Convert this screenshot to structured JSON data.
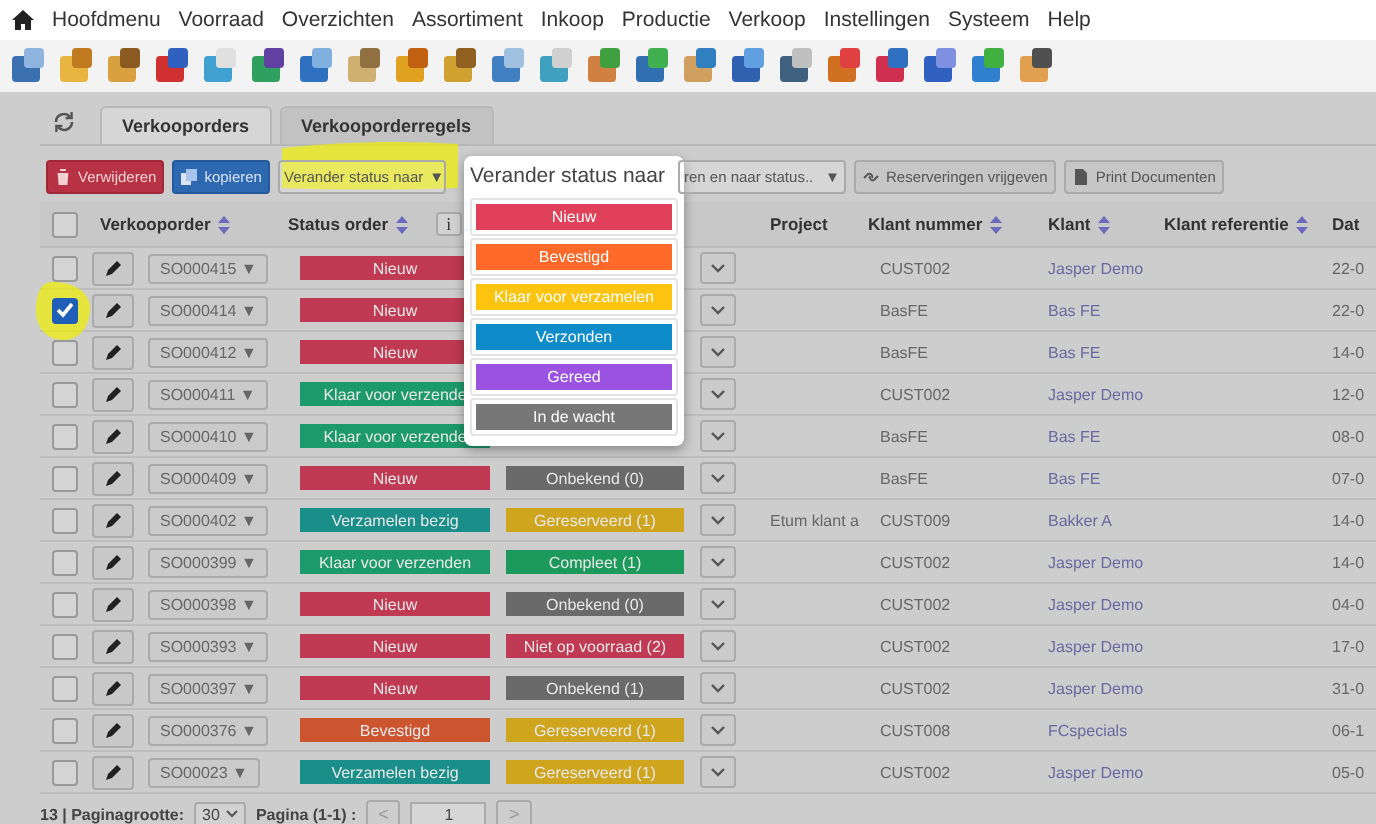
{
  "menu": [
    "Hoofdmenu",
    "Voorraad",
    "Overzichten",
    "Assortiment",
    "Inkoop",
    "Productie",
    "Verkoop",
    "Instellingen",
    "Systeem",
    "Help"
  ],
  "tabs": [
    {
      "label": "Verkooporders",
      "selected": true
    },
    {
      "label": "Verkooporderregels",
      "selected": false
    }
  ],
  "actions": {
    "delete": "Verwijderen",
    "copy": "kopieren",
    "status_select": "Verander status naar",
    "status_select_arrow": "▼",
    "cut_select": "ren en naar status..",
    "cut_select_arrow": "▼",
    "release": "Reserveringen vrijgeven",
    "print": "Print Documenten"
  },
  "columns": {
    "select_all_checked": false,
    "order": "Verkooporder",
    "status": "Status order",
    "info": "i",
    "project": "Project",
    "customer_no": "Klant nummer",
    "customer": "Klant",
    "reference": "Klant referentie",
    "date": "Dat"
  },
  "rows": [
    {
      "checked": false,
      "order": "SO000415 ▼",
      "status": {
        "label": "Nieuw",
        "color": "#bf3a52"
      },
      "customer_no": "CUST002",
      "customer": "Jasper Demo",
      "date": "22-0"
    },
    {
      "checked": true,
      "order": "SO000414 ▼",
      "status": {
        "label": "Nieuw",
        "color": "#bf3a52"
      },
      "customer_no": "BasFE",
      "customer": "Bas FE",
      "date": "22-0"
    },
    {
      "checked": false,
      "order": "SO000412 ▼",
      "status": {
        "label": "Nieuw",
        "color": "#bf3a52"
      },
      "customer_no": "BasFE",
      "customer": "Bas FE",
      "date": "14-0"
    },
    {
      "checked": false,
      "order": "SO000411 ▼",
      "status": {
        "label": "Klaar voor verzende",
        "color": "#1c9a6c"
      },
      "customer_no": "CUST002",
      "customer": "Jasper Demo",
      "date": "12-0"
    },
    {
      "checked": false,
      "order": "SO000410 ▼",
      "status": {
        "label": "Klaar voor verzende",
        "color": "#1c9a6c"
      },
      "customer_no": "BasFE",
      "customer": "Bas FE",
      "date": "08-0"
    },
    {
      "checked": false,
      "order": "SO000409 ▼",
      "status": {
        "label": "Nieuw",
        "color": "#bf3a52"
      },
      "delivery": {
        "label": "Onbekend (0)",
        "color": "#6a6a6a"
      },
      "customer_no": "BasFE",
      "customer": "Bas FE",
      "date": "07-0"
    },
    {
      "checked": false,
      "order": "SO000402 ▼",
      "status": {
        "label": "Verzamelen bezig",
        "color": "#1a8f8a"
      },
      "delivery": {
        "label": "Gereserveerd (1)",
        "color": "#cfa51e"
      },
      "project": "Etum klant a",
      "customer_no": "CUST009",
      "customer": "Bakker A",
      "date": "14-0"
    },
    {
      "checked": false,
      "order": "SO000399 ▼",
      "status": {
        "label": "Klaar voor verzenden",
        "color": "#1c9a6c"
      },
      "delivery": {
        "label": "Compleet (1)",
        "color": "#1c9a5c"
      },
      "customer_no": "CUST002",
      "customer": "Jasper Demo",
      "date": "14-0"
    },
    {
      "checked": false,
      "order": "SO000398 ▼",
      "status": {
        "label": "Nieuw",
        "color": "#bf3a52"
      },
      "delivery": {
        "label": "Onbekend (0)",
        "color": "#6a6a6a"
      },
      "customer_no": "CUST002",
      "customer": "Jasper Demo",
      "date": "04-0"
    },
    {
      "checked": false,
      "order": "SO000393 ▼",
      "status": {
        "label": "Nieuw",
        "color": "#bf3a52"
      },
      "delivery": {
        "label": "Niet op voorraad (2)",
        "color": "#bf3a52"
      },
      "customer_no": "CUST002",
      "customer": "Jasper Demo",
      "date": "17-0"
    },
    {
      "checked": false,
      "order": "SO000397 ▼",
      "status": {
        "label": "Nieuw",
        "color": "#bf3a52"
      },
      "delivery": {
        "label": "Onbekend (1)",
        "color": "#6a6a6a"
      },
      "customer_no": "CUST002",
      "customer": "Jasper Demo",
      "date": "31-0"
    },
    {
      "checked": false,
      "order": "SO000376 ▼",
      "status": {
        "label": "Bevestigd",
        "color": "#cc5530"
      },
      "delivery": {
        "label": "Gereserveerd (1)",
        "color": "#cfa51e"
      },
      "customer_no": "CUST008",
      "customer": "FCspecials",
      "date": "06-1"
    },
    {
      "checked": false,
      "order": "SO00023 ▼",
      "status": {
        "label": "Verzamelen bezig",
        "color": "#1a8f8a"
      },
      "delivery": {
        "label": "Gereserveerd (1)",
        "color": "#cfa51e"
      },
      "customer_no": "CUST002",
      "customer": "Jasper Demo",
      "date": "05-0"
    }
  ],
  "footer": {
    "count": "13 | Paginagrootte:",
    "page_size": "30",
    "page": "Pagina (1-1) :",
    "prev": "<",
    "page_input": "1",
    "next": ">"
  },
  "popup": {
    "title": "Verander status naar",
    "options": [
      {
        "label": "Nieuw",
        "color": "#e0405a"
      },
      {
        "label": "Bevestigd",
        "color": "#ff6a2a"
      },
      {
        "label": "Klaar voor verzamelen",
        "color": "#ffc410"
      },
      {
        "label": "Verzonden",
        "color": "#0e8cca"
      },
      {
        "label": "Gereed",
        "color": "#9b52e0"
      },
      {
        "label": "In de wacht",
        "color": "#777777"
      }
    ]
  }
}
